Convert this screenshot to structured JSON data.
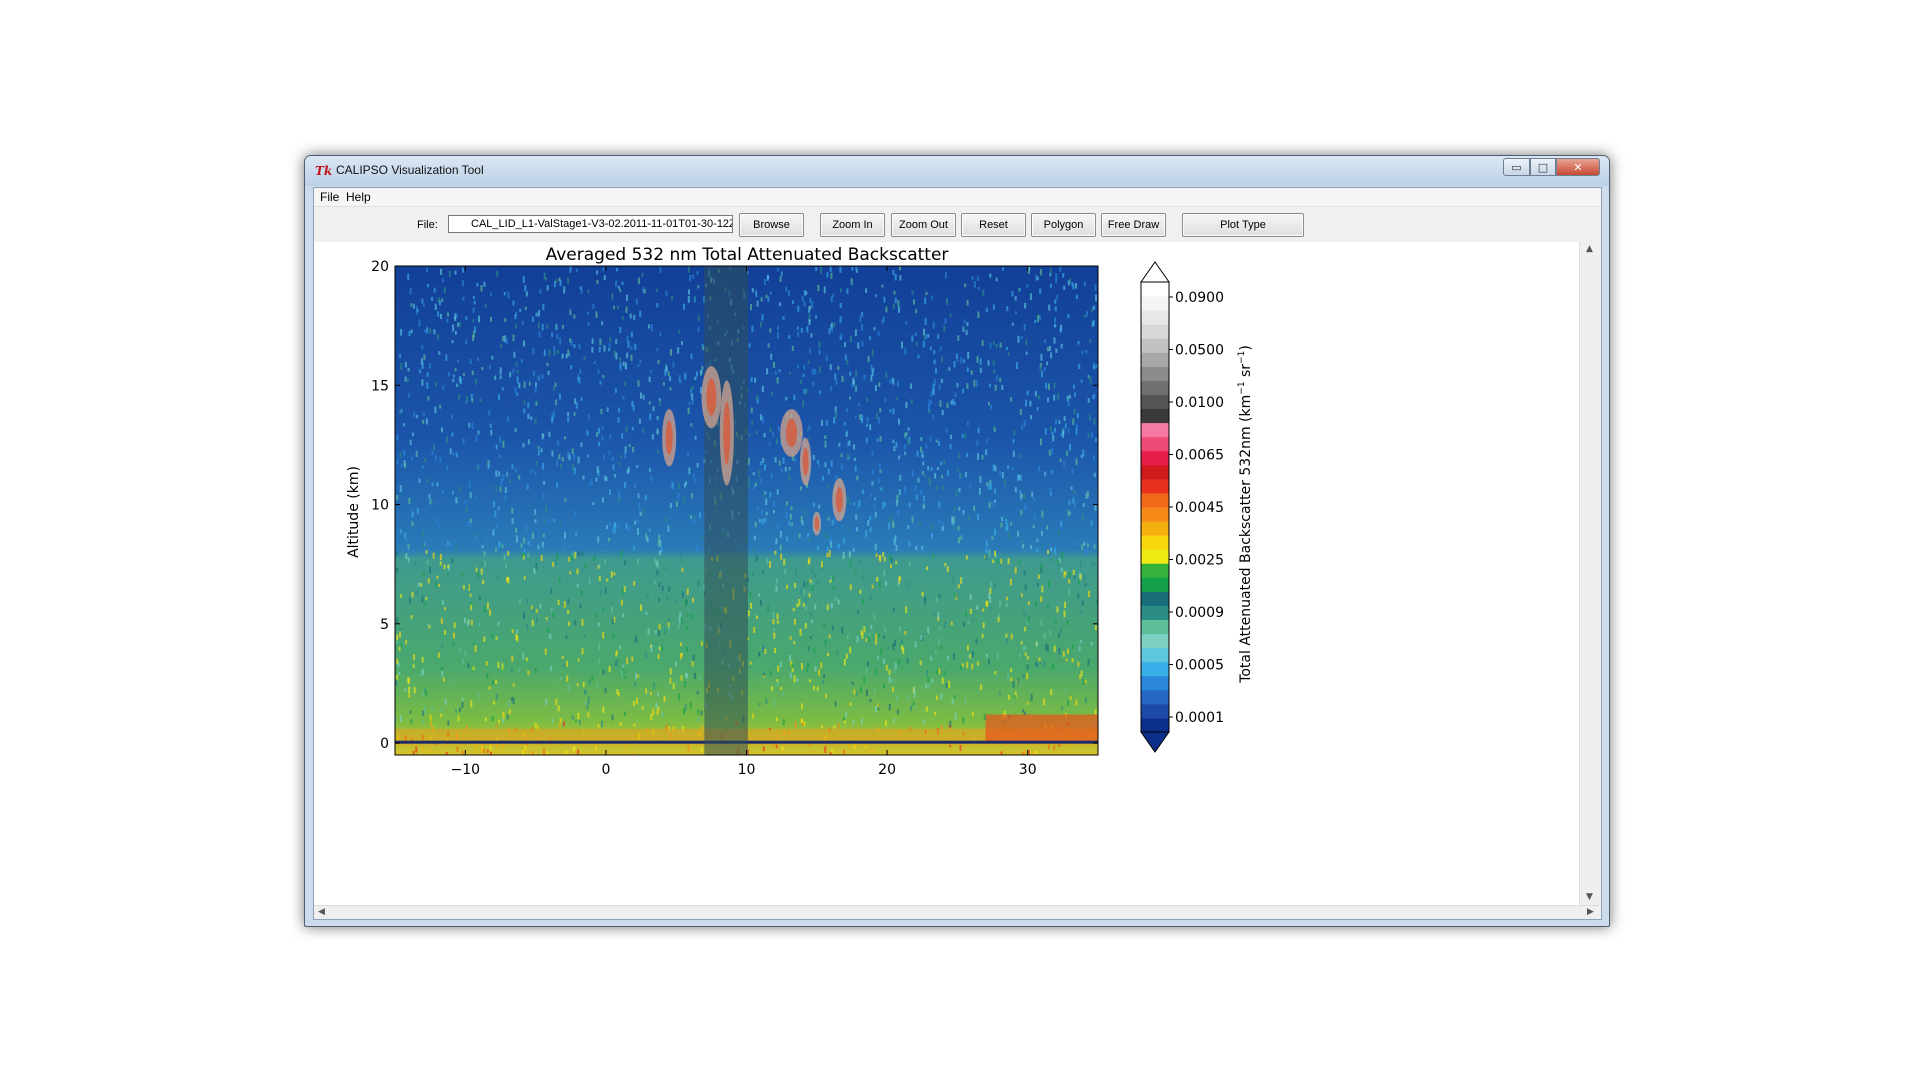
{
  "window": {
    "title": "CALIPSO Visualization Tool",
    "logo_text": "Tk",
    "controls": {
      "minimize": "▭",
      "maximize": "□",
      "close": "✕"
    }
  },
  "menu": {
    "items": [
      "File",
      "Help"
    ]
  },
  "toolbar": {
    "file_label": "File:",
    "file_value": "CAL_LID_L1-ValStage1-V3-02.2011-11-01T01-30-12ZD.hdf",
    "buttons": [
      "Browse",
      "Zoom In",
      "Zoom Out",
      "Reset",
      "Polygon",
      "Free Draw",
      "Plot Type"
    ]
  },
  "chart_data": {
    "type": "heatmap",
    "title": "Averaged 532 nm Total Attenuated Backscatter",
    "xlabel": "",
    "ylabel": "Altitude (km)",
    "xlim": [
      -15,
      35
    ],
    "ylim": [
      -0.5,
      20
    ],
    "x_ticks": [
      "−10",
      "0",
      "10",
      "20",
      "30"
    ],
    "x_tick_values": [
      -10,
      0,
      10,
      20,
      30
    ],
    "y_ticks": [
      "0",
      "5",
      "10",
      "15",
      "20"
    ],
    "y_tick_values": [
      0,
      5,
      10,
      15,
      20
    ],
    "colorbar": {
      "label": "Total Attenuated Backscatter 532nm (km",
      "label_sup1": "−1",
      "label_mid": " sr",
      "label_sup2": "−1",
      "label_end": ")",
      "tick_labels": [
        "0.0001",
        "0.0005",
        "0.0009",
        "0.0025",
        "0.0045",
        "0.0065",
        "0.0100",
        "0.0500",
        "0.0900"
      ],
      "colors": [
        "#0c2f8a",
        "#1c4aa6",
        "#2467c4",
        "#2a86da",
        "#3aaee8",
        "#5ec6de",
        "#7dd0c4",
        "#5fbf9a",
        "#2b8c84",
        "#1a6e7a",
        "#14a04a",
        "#34b23a",
        "#f0ea14",
        "#f7d90e",
        "#f5b010",
        "#f58a18",
        "#f06a1a",
        "#e8301e",
        "#d01a1e",
        "#e81e4a",
        "#f04a7a",
        "#f47aa4",
        "#3a3a3a",
        "#555555",
        "#707070",
        "#8c8c8c",
        "#a8a8a8",
        "#c2c2c2",
        "#d8d8d8",
        "#e8e8e8",
        "#f4f4f4",
        "#ffffff"
      ]
    }
  }
}
